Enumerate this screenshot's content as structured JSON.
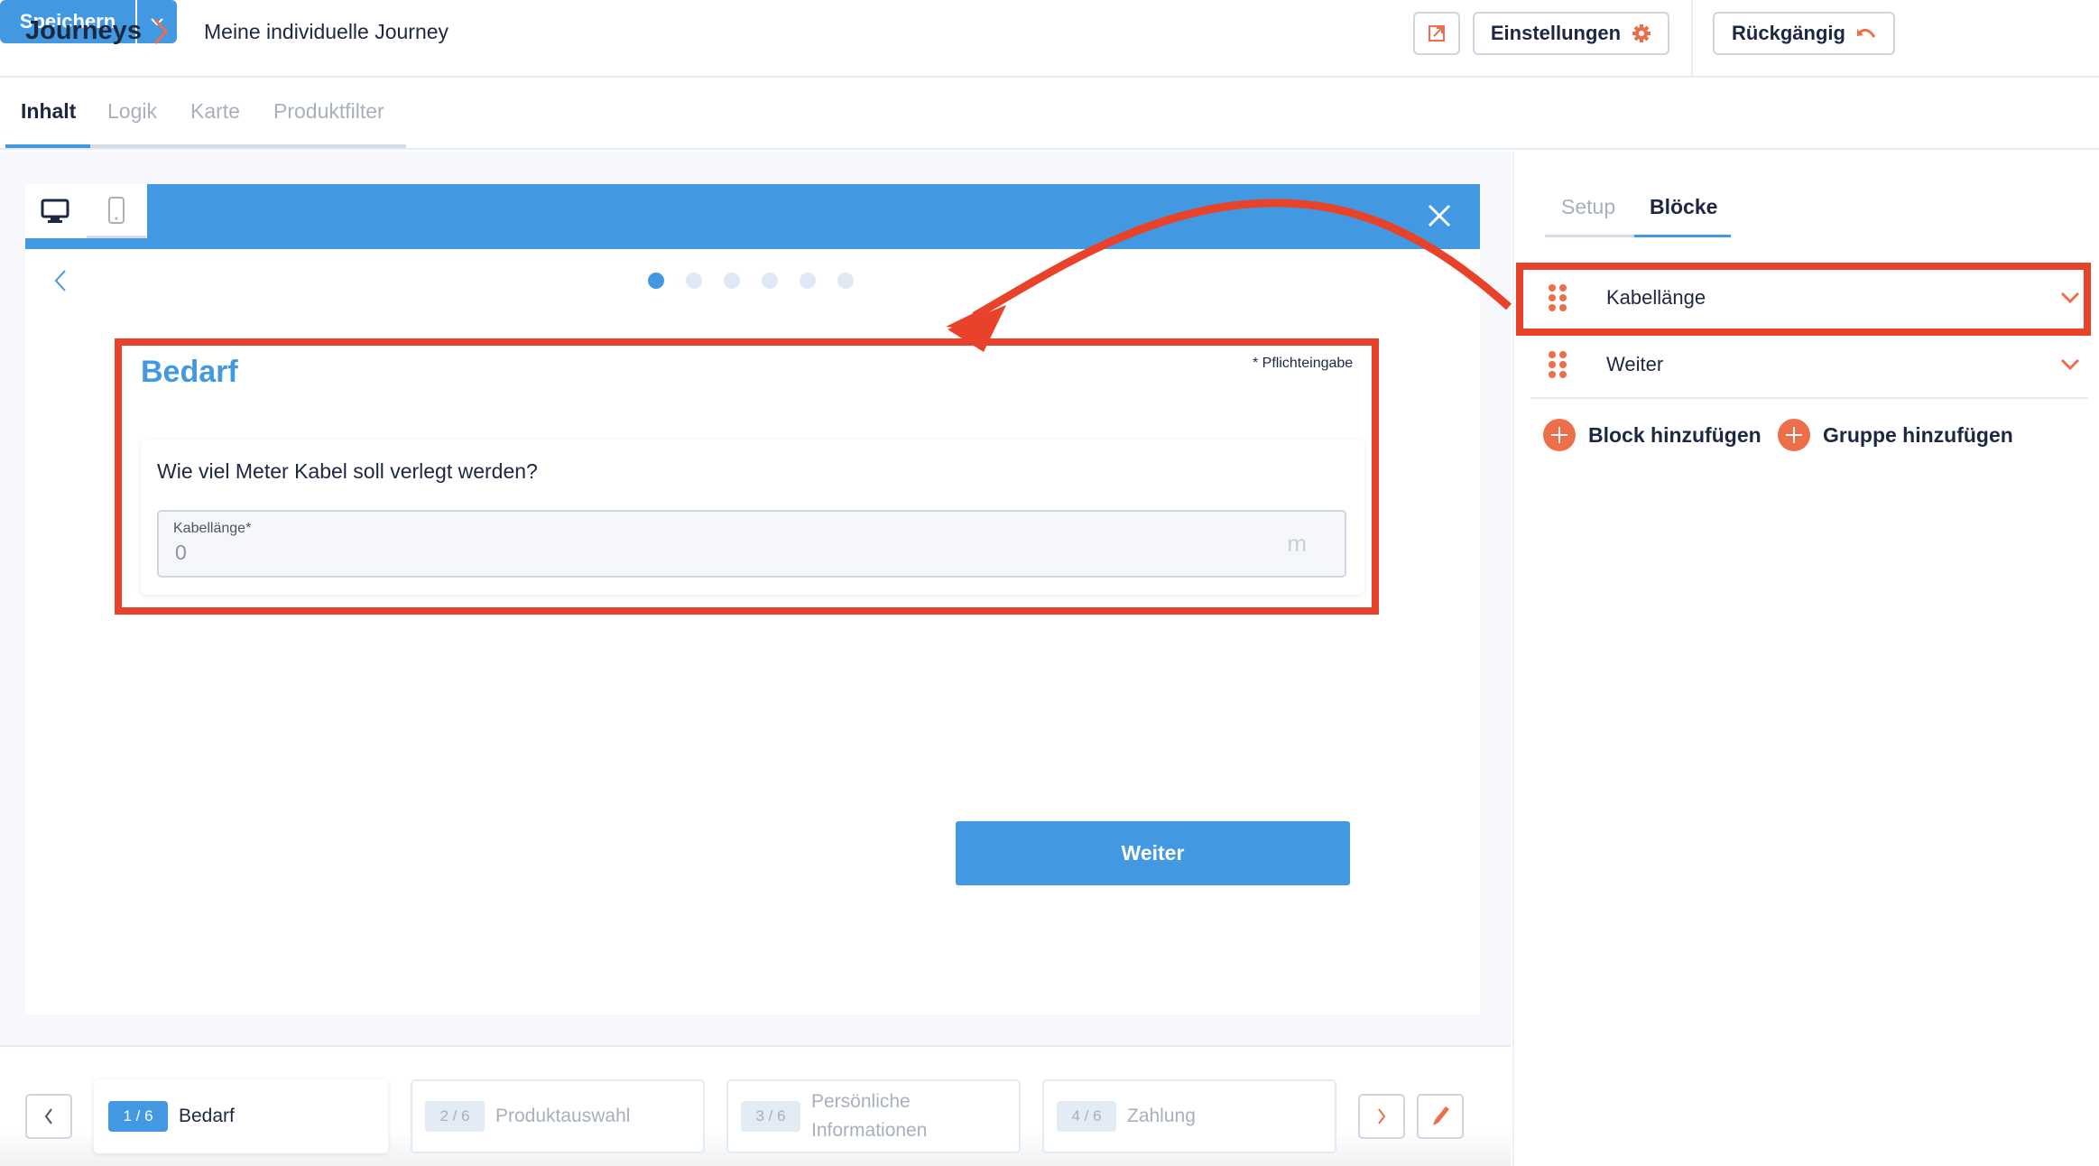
{
  "header": {
    "breadcrumb_root": "Journeys",
    "breadcrumb_page": "Meine individuelle Journey",
    "settings_label": "Einstellungen",
    "undo_label": "Rückgängig",
    "save_label": "Speichern",
    "icons": {
      "external": "external-link-icon",
      "settings": "gear-icon",
      "undo": "undo-icon",
      "dropdown": "chevron-down-icon"
    }
  },
  "tabs": [
    {
      "label": "Inhalt",
      "active": true
    },
    {
      "label": "Logik",
      "active": false
    },
    {
      "label": "Karte",
      "active": false
    },
    {
      "label": "Produktfilter",
      "active": false
    }
  ],
  "preview": {
    "device_modes": [
      "desktop",
      "mobile"
    ],
    "active_device": "desktop",
    "progress_dots": 6,
    "active_dot": 1,
    "step_title": "Bedarf",
    "required_note": "* Pflichteingabe",
    "question": "Wie viel Meter Kabel soll verlegt werden?",
    "field": {
      "label": "Kabellänge",
      "required_mark": "*",
      "value": "0",
      "unit": "m"
    },
    "next_button": "Weiter"
  },
  "steps": [
    {
      "badge": "1 / 6",
      "label": "Bedarf",
      "active": true
    },
    {
      "badge": "2 / 6",
      "label": "Produktauswahl",
      "active": false
    },
    {
      "badge": "3 / 6",
      "label": "Persönliche Informationen",
      "active": false
    },
    {
      "badge": "4 / 6",
      "label": "Zahlung",
      "active": false
    }
  ],
  "panel": {
    "tabs": [
      {
        "label": "Setup",
        "active": false
      },
      {
        "label": "Blöcke",
        "active": true
      }
    ],
    "blocks": [
      {
        "label": "Kabellänge",
        "highlighted": true
      },
      {
        "label": "Weiter",
        "highlighted": false
      }
    ],
    "add_block": "Block hinzufügen",
    "add_group": "Gruppe hinzufügen"
  },
  "colors": {
    "accent": "#4299e1",
    "brand_orange": "#ec6f4a",
    "annotation_red": "#e8432a",
    "text": "#1c2841"
  }
}
